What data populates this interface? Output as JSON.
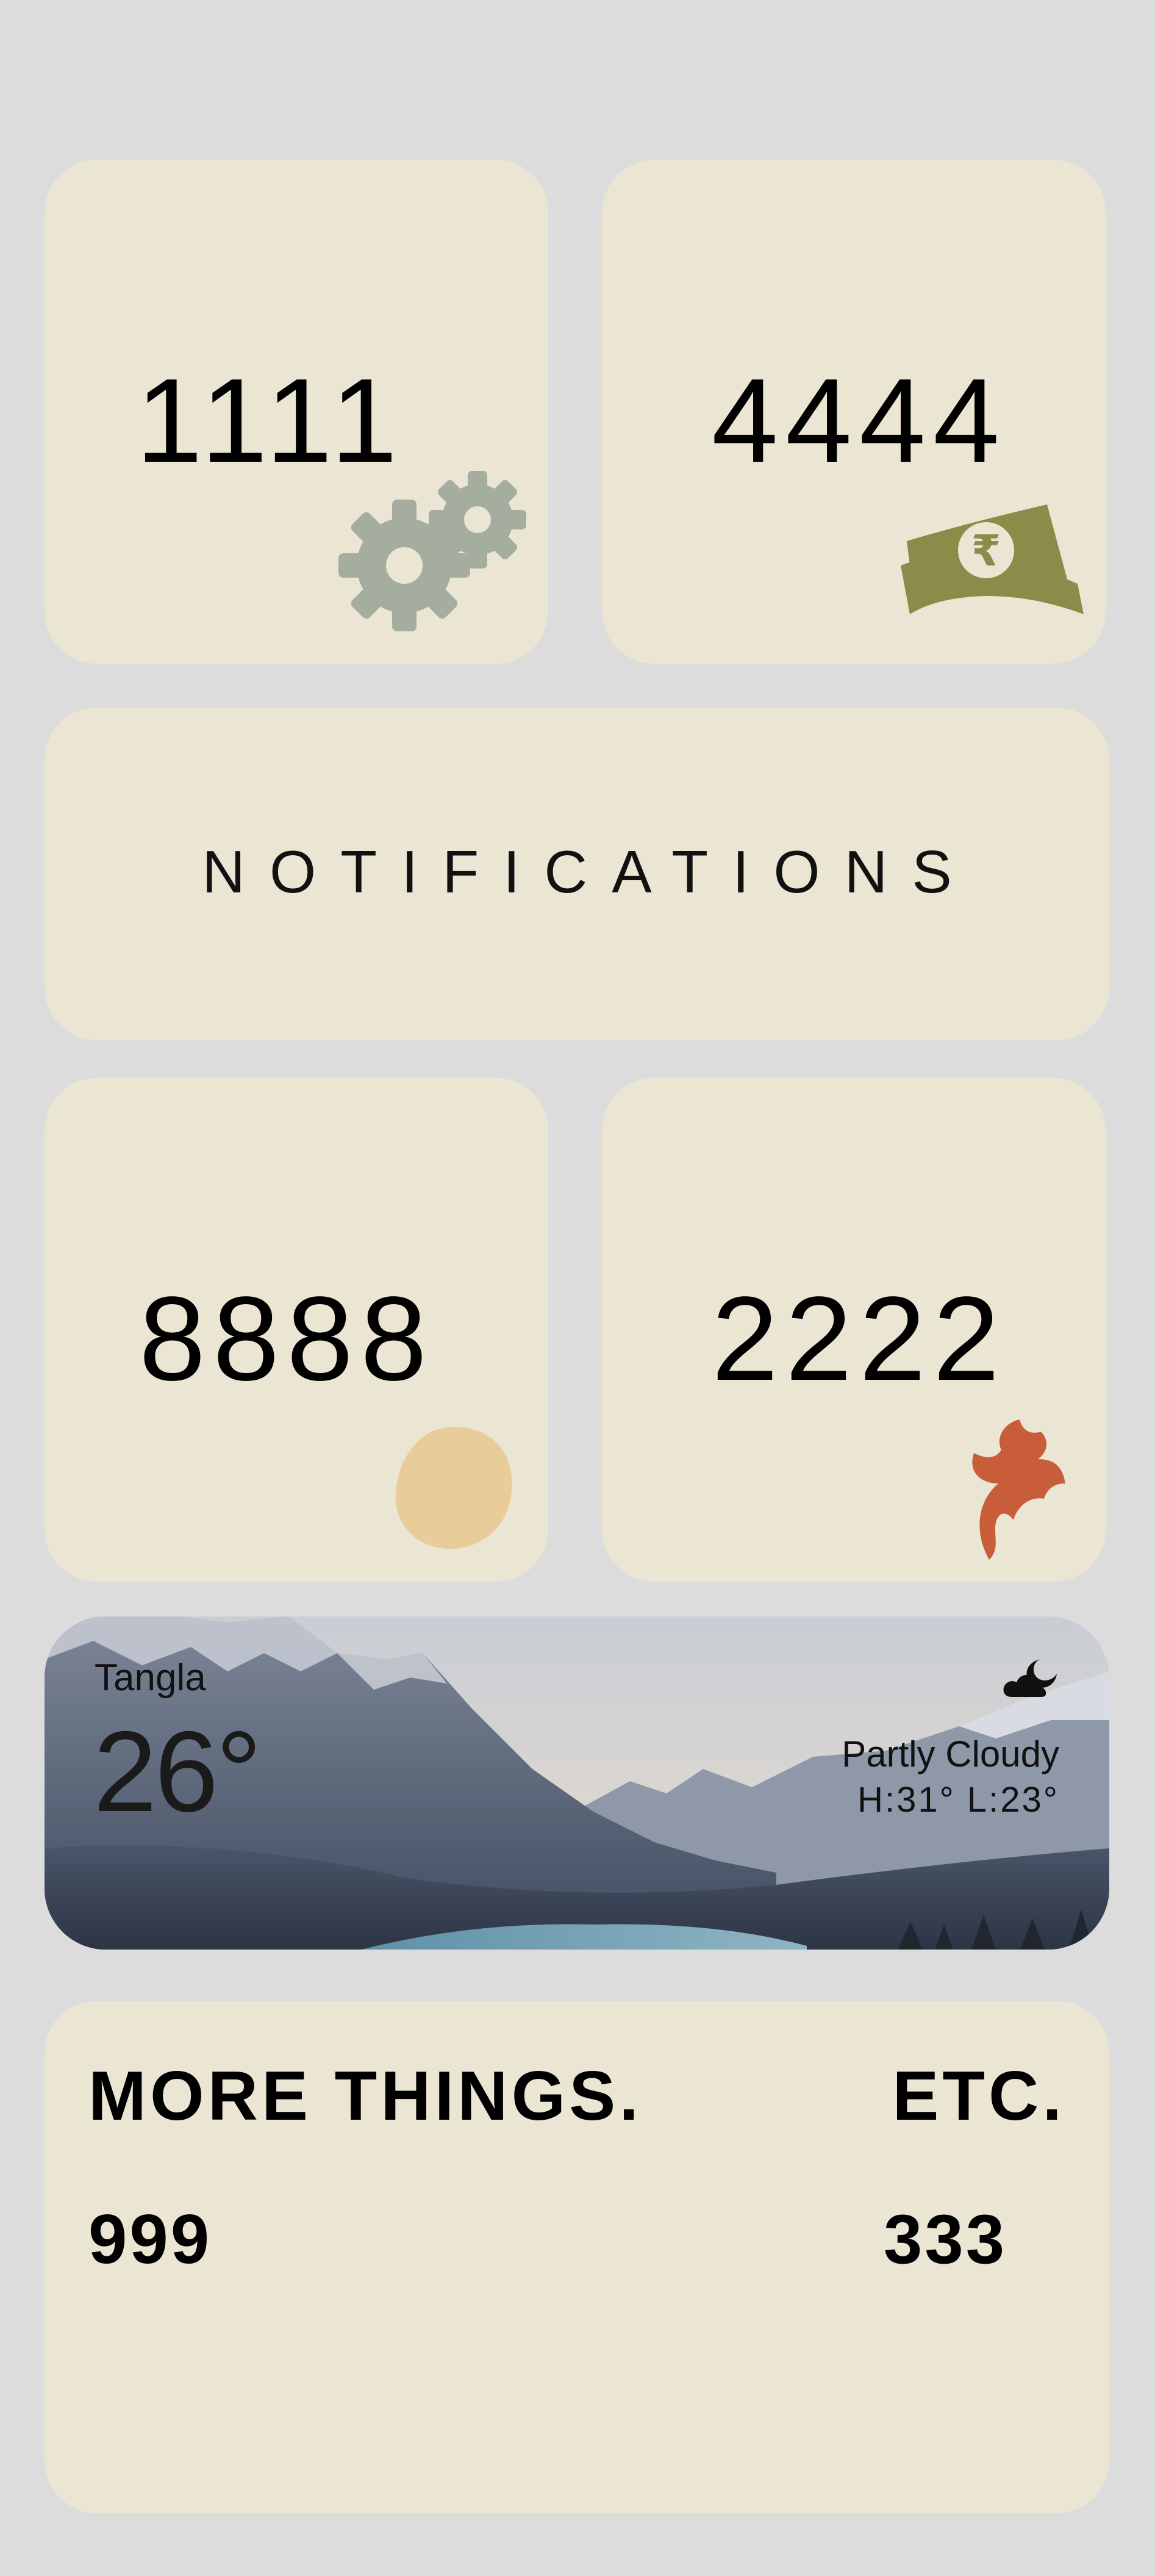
{
  "tiles": {
    "top_left": {
      "value": "1111",
      "icon": "gears-icon",
      "icon_color": "#a5ad9e"
    },
    "top_right": {
      "value": "4444",
      "icon": "rupee-banknote-icon",
      "icon_color": "#8a8d4a"
    },
    "notifications": {
      "label": "NOTIFICATIONS"
    },
    "mid_left": {
      "value": "8888",
      "icon": "egg-icon",
      "icon_color": "#e8cc9a"
    },
    "mid_right": {
      "value": "2222",
      "icon": "leaf-sprig-icon",
      "icon_color": "#c95d3a"
    }
  },
  "weather": {
    "location": "Tangla",
    "temperature": "26°",
    "condition": "Partly Cloudy",
    "high_low": "H:31° L:23°",
    "icon": "partly-cloudy-night-icon"
  },
  "more": {
    "heading_left": "MORE THINGS.",
    "heading_right": "ETC.",
    "value_left": "999",
    "value_right": "333"
  },
  "colors": {
    "page_background": "#dcdcdc",
    "tile_background": "#ebe6d3"
  }
}
